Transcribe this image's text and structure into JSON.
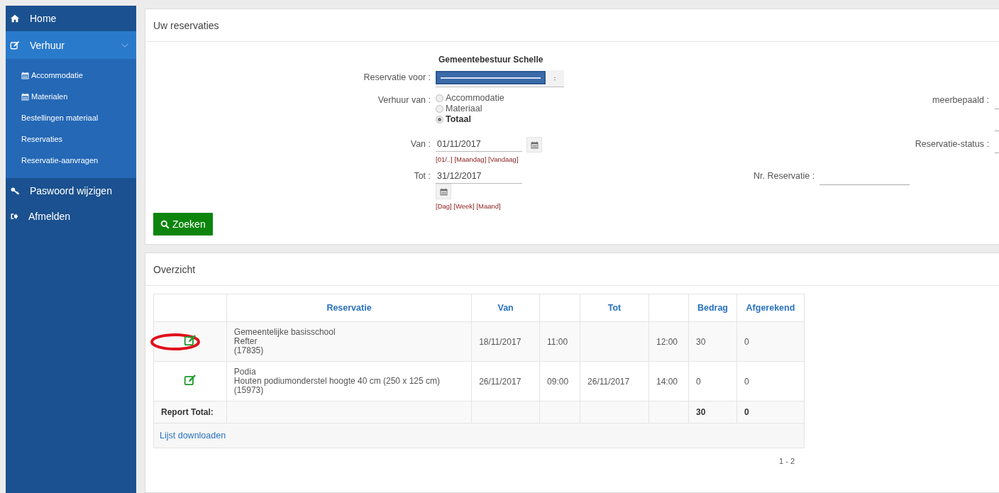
{
  "sidebar": {
    "items": [
      {
        "label": "Home",
        "selected": false
      },
      {
        "label": "Verhuur",
        "selected": true,
        "expanded": true,
        "children": [
          {
            "label": "Accommodatie"
          },
          {
            "label": "Materialen"
          },
          {
            "label": "Bestellingen materiaal"
          },
          {
            "label": "Reservaties"
          },
          {
            "label": "Reservatie-aanvragen"
          }
        ]
      },
      {
        "label": "Paswoord wijzigen",
        "selected": false
      },
      {
        "label": "Afmelden",
        "selected": false
      }
    ]
  },
  "search_panel": {
    "title": "Uw reservaties",
    "organisation": "Gemeentebestuur Schelle",
    "reservatie_voor": {
      "label": "Reservatie voor :"
    },
    "verhuur_van": {
      "label": "Verhuur van :",
      "options": [
        {
          "label": "Accommodatie",
          "selected": false
        },
        {
          "label": "Materiaal",
          "selected": false
        },
        {
          "label": "Totaal",
          "selected": true
        }
      ]
    },
    "van": {
      "label": "Van :",
      "value": "01/11/2017",
      "shortcuts": "[01/..] [Maandag] [Vandaag]"
    },
    "tot": {
      "label": "Tot :",
      "value": "31/12/2017",
      "shortcuts": "[Dag] [Week] [Maand]"
    },
    "meerbepaald": {
      "label": "meerbepaald :"
    },
    "reservatie_status": {
      "label": "Reservatie-status :"
    },
    "nr_reservatie": {
      "label": "Nr. Reservatie :"
    },
    "search_button": "Zoeken"
  },
  "overview_panel": {
    "title": "Overzicht",
    "table": {
      "columns": [
        {},
        {
          "label": "Reservatie"
        },
        {
          "label": "Van"
        },
        {},
        {
          "label": "Tot"
        },
        {},
        {
          "label": "Bedrag"
        },
        {
          "label": "Afgerekend"
        }
      ],
      "rows": [
        {
          "circled": true,
          "reservatie": [
            "Gemeentelijke basisschool",
            "Refter",
            "(17835)"
          ],
          "van": "18/11/2017",
          "van_time": "11:00",
          "tot_time": "12:00",
          "bedrag": "30",
          "afgerekend": "0"
        },
        {
          "circled": false,
          "reservatie": [
            "Podia",
            "Houten podiumonderstel hoogte 40 cm (250 x 125 cm)",
            "(15973)"
          ],
          "van": "26/11/2017",
          "van_time": "09:00",
          "tot": "26/11/2017",
          "tot_time": "14:00",
          "bedrag": "0",
          "afgerekend": "0"
        }
      ],
      "total": {
        "label": "Report Total:",
        "bedrag": "30",
        "afgerekend": "0"
      },
      "download_link": "Lijst downloaden"
    },
    "pagination": "1 - 2"
  }
}
